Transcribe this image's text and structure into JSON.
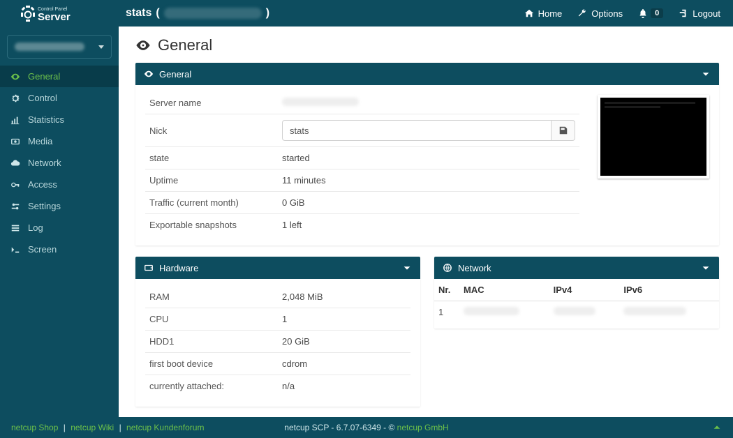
{
  "brand": {
    "top": "Control Panel",
    "main": "Server"
  },
  "topbar": {
    "title_prefix": "stats",
    "home": "Home",
    "options": "Options",
    "notif_count": "0",
    "logout": "Logout"
  },
  "sidebar": {
    "items": [
      {
        "label": "General"
      },
      {
        "label": "Control"
      },
      {
        "label": "Statistics"
      },
      {
        "label": "Media"
      },
      {
        "label": "Network"
      },
      {
        "label": "Access"
      },
      {
        "label": "Settings"
      },
      {
        "label": "Log"
      },
      {
        "label": "Screen"
      }
    ]
  },
  "page": {
    "title": "General"
  },
  "panels": {
    "general": {
      "heading": "General",
      "rows": {
        "server_name_label": "Server name",
        "nick_label": "Nick",
        "nick_value": "stats",
        "state_label": "state",
        "state_value": "started",
        "uptime_label": "Uptime",
        "uptime_value": "11 minutes",
        "traffic_label": "Traffic (current month)",
        "traffic_value": "0 GiB",
        "snapshots_label": "Exportable snapshots",
        "snapshots_value": "1 left"
      }
    },
    "hardware": {
      "heading": "Hardware",
      "rows": {
        "ram_label": "RAM",
        "ram_value": "2,048 MiB",
        "cpu_label": "CPU",
        "cpu_value": "1",
        "hdd_label": "HDD1",
        "hdd_value": "20 GiB",
        "boot_label": "first boot device",
        "boot_value": "cdrom",
        "attached_label": "currently attached:",
        "attached_value": "n/a"
      }
    },
    "network": {
      "heading": "Network",
      "headers": {
        "nr": "Nr.",
        "mac": "MAC",
        "ipv4": "IPv4",
        "ipv6": "IPv6"
      },
      "rows": [
        {
          "nr": "1"
        }
      ]
    }
  },
  "footer": {
    "shop": "netcup Shop",
    "wiki": "netcup Wiki",
    "forum": "netcup Kundenforum",
    "center_prefix": "netcup SCP - 6.7.07-6349 - © ",
    "company": "netcup GmbH"
  }
}
